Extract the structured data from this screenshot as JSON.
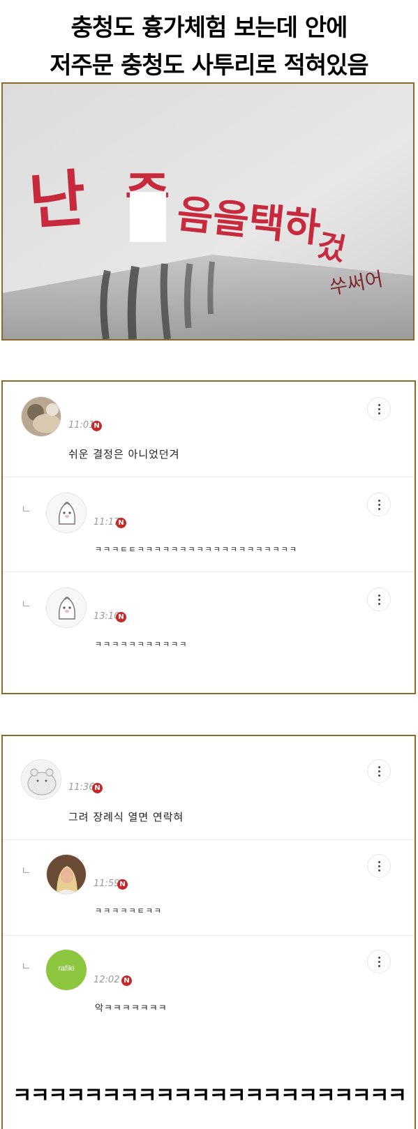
{
  "captions": {
    "line1": "충청도 흉가체험 보는데 안에",
    "line2": "저주문 충청도 사투리로 적혀있음"
  },
  "photo": {
    "graffiti_main": "난 죽음을택하겄어",
    "graffiti_tail": "쑤써어"
  },
  "panel1": {
    "comments": [
      {
        "time": "11:01",
        "badge": "N",
        "text": "쉬운 결정은 아니었던겨"
      },
      {
        "time": "11:17",
        "badge": "N",
        "text": "ㅋㅋㅋㅌㅌㅋㅋㅋㅋㅋㅋㅋㅋㅋㅋㅋㅋㅋㅋㅋㅋㅋㅋㅋ"
      },
      {
        "time": "13:10",
        "badge": "N",
        "text": "ㅋㅋㅋㅋㅋㅋㅋㅋㅋㅋㅋ"
      }
    ]
  },
  "panel2": {
    "comments": [
      {
        "time": "11:36",
        "badge": "N",
        "text": "그려 장례식 열면 연락혀"
      },
      {
        "time": "11:59",
        "badge": "N",
        "text": "ㅋㅋㅋㅋㅋㅌㅋㅋ"
      },
      {
        "time": "12:02",
        "badge": "N",
        "text": "악ㅋㅋㅋㅋㅋㅋㅋ",
        "avatar_label": "rafiki"
      }
    ]
  },
  "reply_icon": "ㄴ",
  "closing_laugh": "ㅋㅋㅋㅋㅋㅋㅋㅋㅋㅋㅋㅋㅋㅋㅋㅋㅋㅋㅋㅋㅋㅋ",
  "colors": {
    "border": "#8b6a2a",
    "badge": "#c62828",
    "graffiti": "#c62a3c",
    "rafiki": "#8dc63f"
  }
}
